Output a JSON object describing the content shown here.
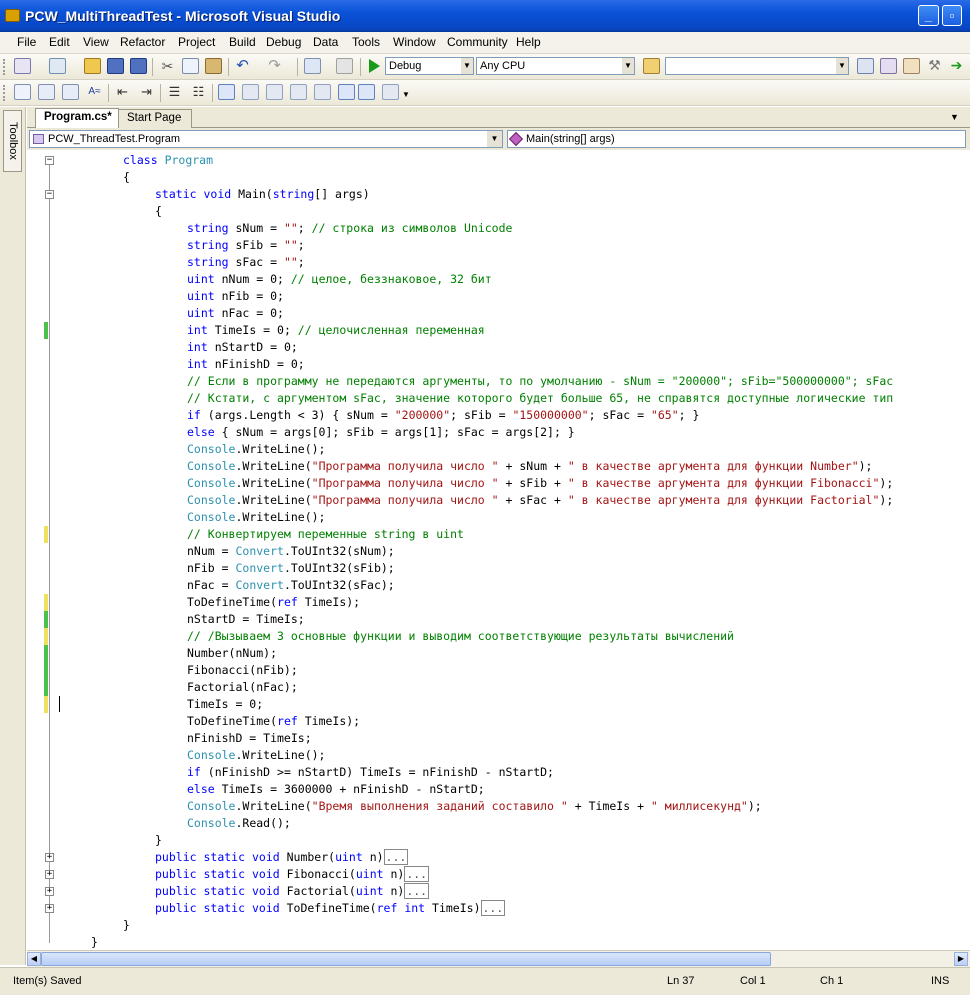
{
  "window": {
    "title": "PCW_MultiThreadTest - Microsoft Visual Studio"
  },
  "menu": [
    "File",
    "Edit",
    "View",
    "Refactor",
    "Project",
    "Build",
    "Debug",
    "Data",
    "Tools",
    "Window",
    "Community",
    "Help"
  ],
  "toolbar": {
    "config": "Debug",
    "platform": "Any CPU",
    "find": ""
  },
  "toolbox_label": "Toolbox",
  "tabs": [
    {
      "label": "Program.cs*"
    },
    {
      "label": "Start Page"
    }
  ],
  "nav": {
    "type": "PCW_ThreadTest.Program",
    "member": "Main(string[] args)"
  },
  "code": [
    {
      "ind": 1,
      "fold": "minus",
      "chg": "",
      "p": [
        [
          "kw",
          "class"
        ],
        [
          "n",
          " "
        ],
        [
          "ty",
          "Program"
        ]
      ]
    },
    {
      "ind": 1,
      "fold": "",
      "chg": "",
      "p": [
        [
          "n",
          "{"
        ]
      ]
    },
    {
      "ind": 2,
      "fold": "minus",
      "chg": "",
      "p": [
        [
          "kw",
          "static"
        ],
        [
          "n",
          " "
        ],
        [
          "kw",
          "void"
        ],
        [
          "n",
          " Main("
        ],
        [
          "kw",
          "string"
        ],
        [
          "n",
          "[] args)"
        ]
      ]
    },
    {
      "ind": 2,
      "fold": "",
      "chg": "",
      "p": [
        [
          "n",
          "{"
        ]
      ]
    },
    {
      "ind": 3,
      "fold": "",
      "chg": "",
      "p": [
        [
          "kw",
          "string"
        ],
        [
          "n",
          " sNum = "
        ],
        [
          "st",
          "\"\""
        ],
        [
          "n",
          "; "
        ],
        [
          "cm",
          "// строка из символов Unicode"
        ]
      ]
    },
    {
      "ind": 3,
      "fold": "",
      "chg": "",
      "p": [
        [
          "kw",
          "string"
        ],
        [
          "n",
          " sFib = "
        ],
        [
          "st",
          "\"\""
        ],
        [
          "n",
          ";"
        ]
      ]
    },
    {
      "ind": 3,
      "fold": "",
      "chg": "",
      "p": [
        [
          "kw",
          "string"
        ],
        [
          "n",
          " sFac = "
        ],
        [
          "st",
          "\"\""
        ],
        [
          "n",
          ";"
        ]
      ]
    },
    {
      "ind": 3,
      "fold": "",
      "chg": "",
      "p": [
        [
          "kw",
          "uint"
        ],
        [
          "n",
          " nNum = 0; "
        ],
        [
          "cm",
          "// целое, беззнаковое, 32 бит"
        ]
      ]
    },
    {
      "ind": 3,
      "fold": "",
      "chg": "",
      "p": [
        [
          "kw",
          "uint"
        ],
        [
          "n",
          " nFib = 0;"
        ]
      ]
    },
    {
      "ind": 3,
      "fold": "",
      "chg": "",
      "p": [
        [
          "kw",
          "uint"
        ],
        [
          "n",
          " nFac = 0;"
        ]
      ]
    },
    {
      "ind": 3,
      "fold": "",
      "chg": "g",
      "p": [
        [
          "kw",
          "int"
        ],
        [
          "n",
          " TimeIs = 0; "
        ],
        [
          "cm",
          "// целочисленная переменная"
        ]
      ]
    },
    {
      "ind": 3,
      "fold": "",
      "chg": "",
      "p": [
        [
          "kw",
          "int"
        ],
        [
          "n",
          " nStartD = 0;"
        ]
      ]
    },
    {
      "ind": 3,
      "fold": "",
      "chg": "",
      "p": [
        [
          "kw",
          "int"
        ],
        [
          "n",
          " nFinishD = 0;"
        ]
      ]
    },
    {
      "ind": 3,
      "fold": "",
      "chg": "",
      "p": [
        [
          "cm",
          "// Если в программу не передаются аргументы, то по умолчанию - sNum = \"200000\"; sFib=\"500000000\"; sFac"
        ]
      ]
    },
    {
      "ind": 3,
      "fold": "",
      "chg": "",
      "p": [
        [
          "cm",
          "// Кстати, с аргументом sFac, значение которого будет больше 65, не справятся доступные логические тип"
        ]
      ]
    },
    {
      "ind": 3,
      "fold": "",
      "chg": "",
      "p": [
        [
          "kw",
          "if"
        ],
        [
          "n",
          " (args.Length < 3) { sNum = "
        ],
        [
          "st",
          "\"200000\""
        ],
        [
          "n",
          "; sFib = "
        ],
        [
          "st",
          "\"150000000\""
        ],
        [
          "n",
          "; sFac = "
        ],
        [
          "st",
          "\"65\""
        ],
        [
          "n",
          "; }"
        ]
      ]
    },
    {
      "ind": 3,
      "fold": "",
      "chg": "",
      "p": [
        [
          "kw",
          "else"
        ],
        [
          "n",
          " { sNum = args[0]; sFib = args[1]; sFac = args[2]; }"
        ]
      ]
    },
    {
      "ind": 3,
      "fold": "",
      "chg": "",
      "p": [
        [
          "cs",
          "Console"
        ],
        [
          "n",
          ".WriteLine();"
        ]
      ]
    },
    {
      "ind": 3,
      "fold": "",
      "chg": "",
      "p": [
        [
          "cs",
          "Console"
        ],
        [
          "n",
          ".WriteLine("
        ],
        [
          "st",
          "\"Программа получила число \""
        ],
        [
          "n",
          " + sNum + "
        ],
        [
          "st",
          "\" в качестве аргумента для функции Number\""
        ],
        [
          "n",
          ");"
        ]
      ]
    },
    {
      "ind": 3,
      "fold": "",
      "chg": "",
      "p": [
        [
          "cs",
          "Console"
        ],
        [
          "n",
          ".WriteLine("
        ],
        [
          "st",
          "\"Программа получила число \""
        ],
        [
          "n",
          " + sFib + "
        ],
        [
          "st",
          "\" в качестве аргумента для функции Fibonacci\""
        ],
        [
          "n",
          ");"
        ]
      ]
    },
    {
      "ind": 3,
      "fold": "",
      "chg": "",
      "p": [
        [
          "cs",
          "Console"
        ],
        [
          "n",
          ".WriteLine("
        ],
        [
          "st",
          "\"Программа получила число \""
        ],
        [
          "n",
          " + sFac + "
        ],
        [
          "st",
          "\" в качестве аргумента для функции Factorial\""
        ],
        [
          "n",
          ");"
        ]
      ]
    },
    {
      "ind": 3,
      "fold": "",
      "chg": "",
      "p": [
        [
          "cs",
          "Console"
        ],
        [
          "n",
          ".WriteLine();"
        ]
      ]
    },
    {
      "ind": 3,
      "fold": "",
      "chg": "y",
      "p": [
        [
          "cm",
          "// Конвертируем переменные string в uint"
        ]
      ]
    },
    {
      "ind": 3,
      "fold": "",
      "chg": "",
      "p": [
        [
          "n",
          "nNum = "
        ],
        [
          "cs",
          "Convert"
        ],
        [
          "n",
          ".ToUInt32(sNum);"
        ]
      ]
    },
    {
      "ind": 3,
      "fold": "",
      "chg": "",
      "p": [
        [
          "n",
          "nFib = "
        ],
        [
          "cs",
          "Convert"
        ],
        [
          "n",
          ".ToUInt32(sFib);"
        ]
      ]
    },
    {
      "ind": 3,
      "fold": "",
      "chg": "",
      "p": [
        [
          "n",
          "nFac = "
        ],
        [
          "cs",
          "Convert"
        ],
        [
          "n",
          ".ToUInt32(sFac);"
        ]
      ]
    },
    {
      "ind": 3,
      "fold": "",
      "chg": "y",
      "p": [
        [
          "n",
          "ToDefineTime("
        ],
        [
          "kw",
          "ref"
        ],
        [
          "n",
          " TimeIs);"
        ]
      ]
    },
    {
      "ind": 3,
      "fold": "",
      "chg": "g",
      "p": [
        [
          "n",
          "nStartD = TimeIs;"
        ]
      ]
    },
    {
      "ind": 3,
      "fold": "",
      "chg": "y",
      "p": [
        [
          "cm",
          "// /Вызываем 3 основные функции и выводим соответствующие результаты вычислений"
        ]
      ]
    },
    {
      "ind": 3,
      "fold": "",
      "chg": "g",
      "p": [
        [
          "n",
          "Number(nNum);"
        ]
      ]
    },
    {
      "ind": 3,
      "fold": "",
      "chg": "g",
      "p": [
        [
          "n",
          "Fibonacci(nFib);"
        ]
      ]
    },
    {
      "ind": 3,
      "fold": "",
      "chg": "g",
      "p": [
        [
          "n",
          "Factorial(nFac);"
        ]
      ]
    },
    {
      "ind": 3,
      "fold": "",
      "chg": "y",
      "p": [
        [
          "n",
          "TimeIs = 0;"
        ]
      ]
    },
    {
      "ind": 3,
      "fold": "",
      "chg": "",
      "p": [
        [
          "n",
          "ToDefineTime("
        ],
        [
          "kw",
          "ref"
        ],
        [
          "n",
          " TimeIs);"
        ]
      ]
    },
    {
      "ind": 3,
      "fold": "",
      "chg": "",
      "p": [
        [
          "n",
          "nFinishD = TimeIs;"
        ]
      ]
    },
    {
      "ind": 3,
      "fold": "",
      "chg": "",
      "p": [
        [
          "cs",
          "Console"
        ],
        [
          "n",
          ".WriteLine();"
        ]
      ]
    },
    {
      "ind": 3,
      "fold": "",
      "chg": "",
      "p": [
        [
          "kw",
          "if"
        ],
        [
          "n",
          " (nFinishD >= nStartD) TimeIs = nFinishD - nStartD;"
        ]
      ]
    },
    {
      "ind": 3,
      "fold": "",
      "chg": "",
      "p": [
        [
          "kw",
          "else"
        ],
        [
          "n",
          " TimeIs = 3600000 + nFinishD - nStartD;"
        ]
      ]
    },
    {
      "ind": 3,
      "fold": "",
      "chg": "",
      "p": [
        [
          "cs",
          "Console"
        ],
        [
          "n",
          ".WriteLine("
        ],
        [
          "st",
          "\"Время выполнения заданий составило \""
        ],
        [
          "n",
          " + TimeIs + "
        ],
        [
          "st",
          "\" миллисекунд\""
        ],
        [
          "n",
          ");"
        ]
      ]
    },
    {
      "ind": 3,
      "fold": "",
      "chg": "",
      "p": [
        [
          "cs",
          "Console"
        ],
        [
          "n",
          ".Read();"
        ]
      ]
    },
    {
      "ind": 2,
      "fold": "",
      "chg": "",
      "p": [
        [
          "n",
          "}"
        ]
      ]
    },
    {
      "ind": 2,
      "fold": "plus",
      "chg": "",
      "p": [
        [
          "kw",
          "public"
        ],
        [
          "n",
          " "
        ],
        [
          "kw",
          "static"
        ],
        [
          "n",
          " "
        ],
        [
          "kw",
          "void"
        ],
        [
          "n",
          " Number("
        ],
        [
          "kw",
          "uint"
        ],
        [
          "n",
          " n)"
        ],
        [
          "box",
          "..."
        ]
      ]
    },
    {
      "ind": 2,
      "fold": "plus",
      "chg": "",
      "p": [
        [
          "kw",
          "public"
        ],
        [
          "n",
          " "
        ],
        [
          "kw",
          "static"
        ],
        [
          "n",
          " "
        ],
        [
          "kw",
          "void"
        ],
        [
          "n",
          " Fibonacci("
        ],
        [
          "kw",
          "uint"
        ],
        [
          "n",
          " n)"
        ],
        [
          "box",
          "..."
        ]
      ]
    },
    {
      "ind": 2,
      "fold": "plus",
      "chg": "",
      "p": [
        [
          "kw",
          "public"
        ],
        [
          "n",
          " "
        ],
        [
          "kw",
          "static"
        ],
        [
          "n",
          " "
        ],
        [
          "kw",
          "void"
        ],
        [
          "n",
          " Factorial("
        ],
        [
          "kw",
          "uint"
        ],
        [
          "n",
          " n)"
        ],
        [
          "box",
          "..."
        ]
      ]
    },
    {
      "ind": 2,
      "fold": "plus",
      "chg": "",
      "p": [
        [
          "kw",
          "public"
        ],
        [
          "n",
          " "
        ],
        [
          "kw",
          "static"
        ],
        [
          "n",
          " "
        ],
        [
          "kw",
          "void"
        ],
        [
          "n",
          " ToDefineTime("
        ],
        [
          "kw",
          "ref"
        ],
        [
          "n",
          " "
        ],
        [
          "kw",
          "int"
        ],
        [
          "n",
          " TimeIs)"
        ],
        [
          "box",
          "..."
        ]
      ]
    },
    {
      "ind": 1,
      "fold": "",
      "chg": "",
      "p": [
        [
          "n",
          "}"
        ]
      ]
    },
    {
      "ind": 0,
      "fold": "",
      "chg": "",
      "p": [
        [
          "n",
          "}"
        ]
      ]
    }
  ],
  "status": {
    "message": "Item(s) Saved",
    "line": "Ln 37",
    "col": "Col 1",
    "ch": "Ch 1",
    "mode": "INS"
  }
}
